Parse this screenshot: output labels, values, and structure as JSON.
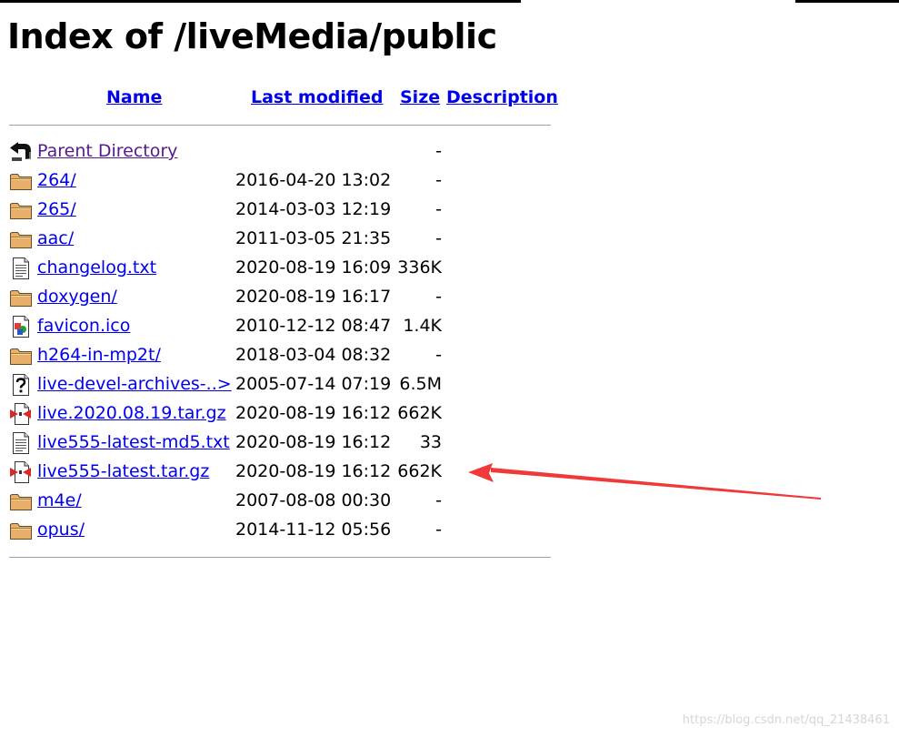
{
  "page": {
    "title": "Index of /liveMedia/public"
  },
  "columns": {
    "name": "Name",
    "last_modified": "Last modified",
    "size": "Size",
    "description": "Description"
  },
  "rows": [
    {
      "icon": "parent-directory-icon",
      "name": "Parent Directory",
      "modified": "",
      "size": "-"
    },
    {
      "icon": "folder-icon",
      "name": "264/",
      "modified": "2016-04-20 13:02",
      "size": "-"
    },
    {
      "icon": "folder-icon",
      "name": "265/",
      "modified": "2014-03-03 12:19",
      "size": "-"
    },
    {
      "icon": "folder-icon",
      "name": "aac/",
      "modified": "2011-03-05 21:35",
      "size": "-"
    },
    {
      "icon": "text-file-icon",
      "name": "changelog.txt",
      "modified": "2020-08-19 16:09",
      "size": "336K"
    },
    {
      "icon": "folder-icon",
      "name": "doxygen/",
      "modified": "2020-08-19 16:17",
      "size": "-"
    },
    {
      "icon": "image-file-icon",
      "name": "favicon.ico",
      "modified": "2010-12-12 08:47",
      "size": "1.4K"
    },
    {
      "icon": "folder-icon",
      "name": "h264-in-mp2t/",
      "modified": "2018-03-04 08:32",
      "size": "-"
    },
    {
      "icon": "unknown-file-icon",
      "name": "live-devel-archives-..>",
      "modified": "2005-07-14 07:19",
      "size": "6.5M"
    },
    {
      "icon": "compressed-file-icon",
      "name": "live.2020.08.19.tar.gz",
      "modified": "2020-08-19 16:12",
      "size": "662K"
    },
    {
      "icon": "text-file-icon",
      "name": "live555-latest-md5.txt",
      "modified": "2020-08-19 16:12",
      "size": "33"
    },
    {
      "icon": "compressed-file-icon",
      "name": "live555-latest.tar.gz",
      "modified": "2020-08-19 16:12",
      "size": "662K"
    },
    {
      "icon": "folder-icon",
      "name": "m4e/",
      "modified": "2007-08-08 00:30",
      "size": "-"
    },
    {
      "icon": "folder-icon",
      "name": "opus/",
      "modified": "2014-11-12 05:56",
      "size": "-"
    }
  ],
  "annotation": {
    "icon": "red-arrow-icon",
    "color": "#f03a3a",
    "points_to": "live555-latest.tar.gz"
  },
  "watermark": "https://blog.csdn.net/qq_21438461",
  "colors": {
    "link": "#0000ee",
    "visited_link": "#551a8b",
    "rule": "#a0a0a0",
    "folder": "#e8b070"
  }
}
